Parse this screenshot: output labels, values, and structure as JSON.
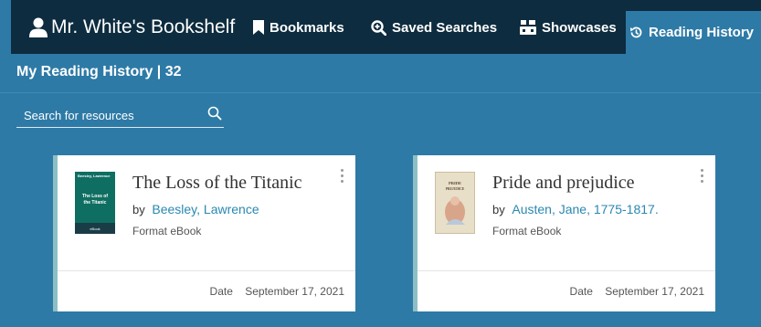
{
  "header": {
    "brand": "Mr. White's Bookshelf",
    "nav": [
      {
        "label": "Bookmarks"
      },
      {
        "label": "Saved Searches"
      },
      {
        "label": "Showcases"
      },
      {
        "label": "Reading History"
      }
    ]
  },
  "page": {
    "title": "My Reading History | 32"
  },
  "search": {
    "placeholder": "Search for resources"
  },
  "items": [
    {
      "title": "The Loss of the Titanic",
      "by_prefix": "by",
      "author": "Beesley, Lawrence",
      "format_label": "Format",
      "format": "eBook",
      "date_label": "Date",
      "date": "September 17, 2021",
      "cover": {
        "top": "Beesley, Lawrence",
        "line1": "The Loss of",
        "line2": "the Titanic",
        "bottom": "eBook"
      }
    },
    {
      "title": "Pride and prejudice",
      "by_prefix": "by",
      "author": "Austen, Jane, 1775-1817.",
      "format_label": "Format",
      "format": "eBook",
      "date_label": "Date",
      "date": "September 17, 2021",
      "cover": {
        "line1": "PRIDE",
        "line2": "PREJUDICE"
      }
    }
  ],
  "colors": {
    "background": "#2e7aa6",
    "topbar": "#0d2c3f",
    "link": "#2a88b0",
    "card_accent": "#8cbfc5"
  }
}
